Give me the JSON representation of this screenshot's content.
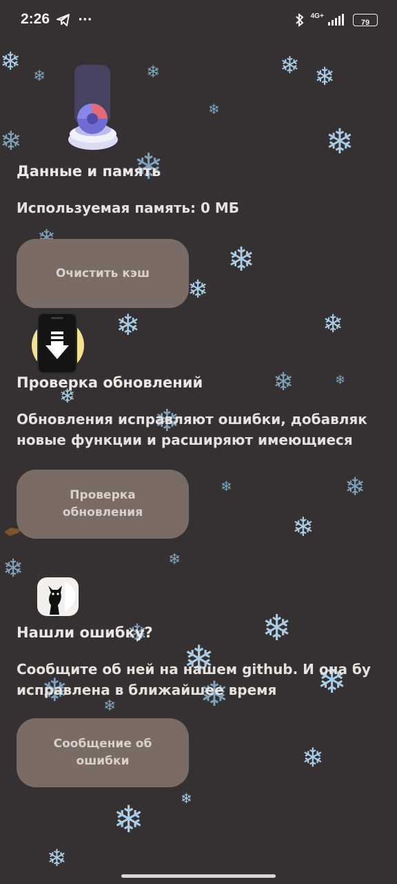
{
  "status_bar": {
    "time": "2:26",
    "more": "···",
    "network": "4G+",
    "battery": "79"
  },
  "sections": [
    {
      "icon": "storage-icon",
      "heading": "Данные и память",
      "text": "Используемая память: 0 МБ",
      "button": "Очистить кэш"
    },
    {
      "icon": "phone-download-icon",
      "heading": "Проверка обновлений",
      "text": "Обновления исправляют ошибки, добавляк\nновые функции и расширяют имеющиеся",
      "button": "Проверка\nобновления"
    },
    {
      "icon": "github-cat-icon",
      "heading": "Нашли ошибку?",
      "text": "Сообщите об ней на нашем github. И она бу\nисправлена в ближайшее время",
      "button": "Сообщение об\nошибки"
    }
  ],
  "colors": {
    "background": "#353132",
    "button": "#7a6c65",
    "snowflake": "#a9cde6"
  }
}
